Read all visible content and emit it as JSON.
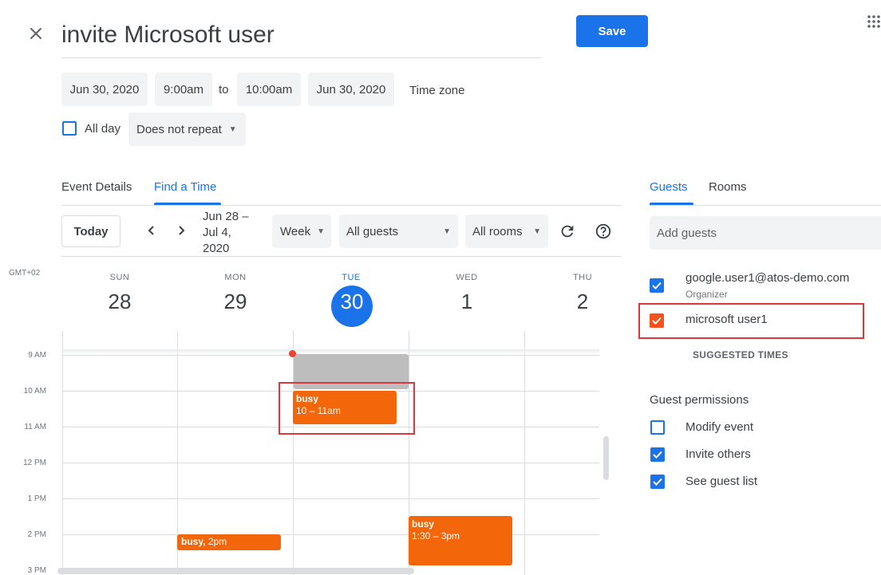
{
  "header": {
    "title": "invite Microsoft user",
    "save_label": "Save"
  },
  "datetime": {
    "start_date": "Jun 30, 2020",
    "start_time": "9:00am",
    "to_label": "to",
    "end_time": "10:00am",
    "end_date": "Jun 30, 2020",
    "timezone_label": "Time zone",
    "all_day_label": "All day",
    "repeat_label": "Does not repeat"
  },
  "tabs": {
    "event_details": "Event Details",
    "find_a_time": "Find a Time"
  },
  "toolbar": {
    "today_label": "Today",
    "range_line1": "Jun 28 –",
    "range_line2": "Jul 4,",
    "range_line3": "2020",
    "view_label": "Week",
    "guests_filter": "All guests",
    "rooms_filter": "All rooms"
  },
  "calendar": {
    "timezone": "GMT+02",
    "days": [
      {
        "name": "SUN",
        "num": "28"
      },
      {
        "name": "MON",
        "num": "29"
      },
      {
        "name": "TUE",
        "num": "30"
      },
      {
        "name": "WED",
        "num": "1"
      },
      {
        "name": "THU",
        "num": "2"
      }
    ],
    "hours": [
      "9 AM",
      "10 AM",
      "11 AM",
      "12 PM",
      "1 PM",
      "2 PM",
      "3 PM"
    ],
    "events": [
      {
        "title": "busy",
        "time": "10 – 11am"
      },
      {
        "title": "busy",
        "time": "2pm"
      },
      {
        "title": "busy",
        "time": "1:30 – 3pm"
      }
    ]
  },
  "guests_panel": {
    "tab_guests": "Guests",
    "tab_rooms": "Rooms",
    "add_placeholder": "Add guests",
    "guests": [
      {
        "name": "google.user1@atos-demo.com",
        "role": "Organizer"
      },
      {
        "name": "microsoft user1",
        "role": ""
      }
    ],
    "suggested_times": "SUGGESTED TIMES",
    "permissions_title": "Guest permissions",
    "permissions": [
      {
        "label": "Modify event",
        "checked": false
      },
      {
        "label": "Invite others",
        "checked": true
      },
      {
        "label": "See guest list",
        "checked": true
      }
    ]
  },
  "colors": {
    "accent": "#1a73e8",
    "busy": "#f4660a",
    "highlight_box": "#d9363e",
    "guest_orange": "#f4511e"
  }
}
